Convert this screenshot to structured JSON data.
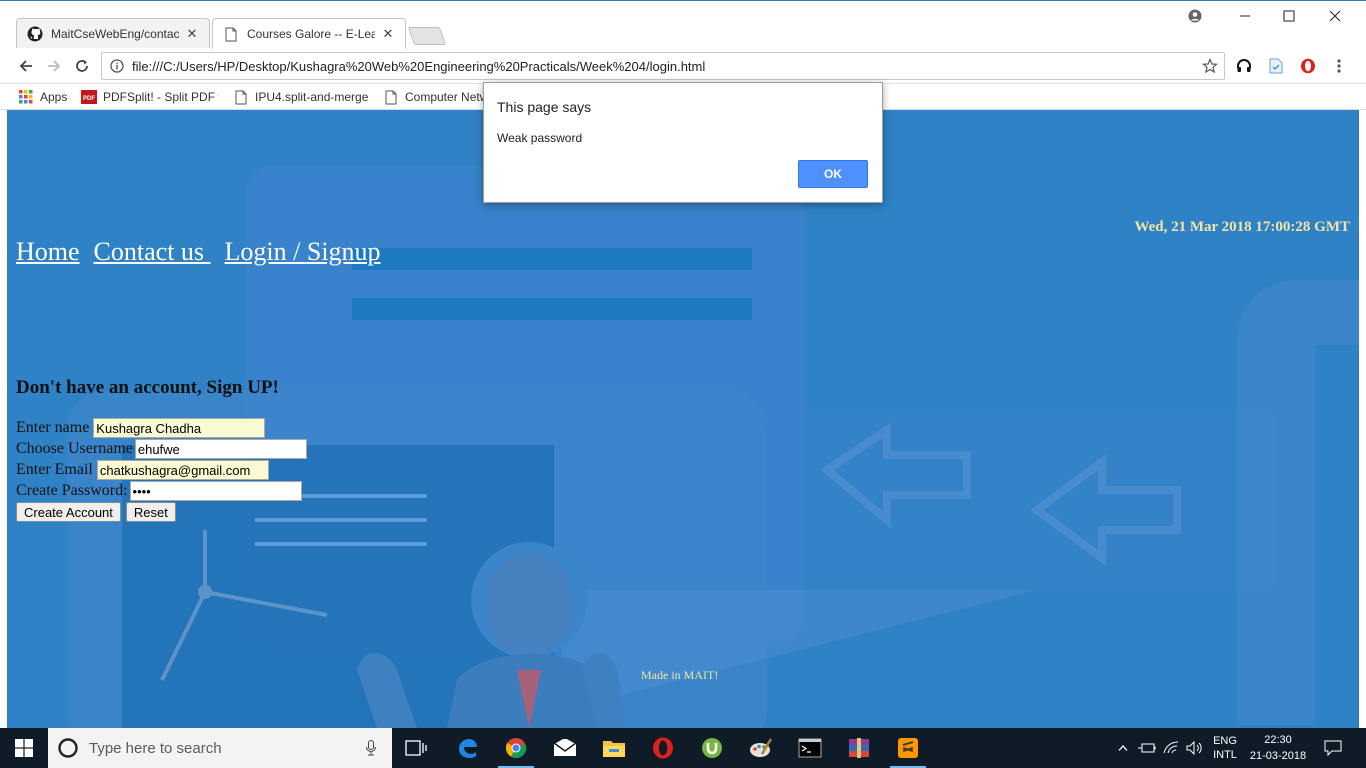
{
  "browser": {
    "tabs": [
      {
        "title": "MaitCseWebEng/contact",
        "active": false,
        "icon": "github-icon"
      },
      {
        "title": "Courses Galore -- E-Lear",
        "active": true,
        "icon": "page-icon"
      }
    ],
    "url": "file:///C:/Users/HP/Desktop/Kushagra%20Web%20Engineering%20Practicals/Week%204/login.html",
    "bookmarks": [
      {
        "label": "Apps",
        "icon": "apps-grid-icon"
      },
      {
        "label": "PDFSplit! - Split PDF f",
        "icon": "pdf-icon"
      },
      {
        "label": "IPU4.split-and-merge",
        "icon": "page-icon"
      },
      {
        "label": "Computer Netw",
        "icon": "page-icon"
      }
    ]
  },
  "page": {
    "datetime": "Wed, 21 Mar 2018 17:00:28 GMT",
    "nav": [
      "Home",
      "Contact us ",
      "Login / Signup"
    ],
    "signup_heading": "Don't have an account, Sign UP!",
    "form": {
      "name_label": "Enter name",
      "name_value": "Kushagra Chadha",
      "username_label": "Choose Username",
      "username_value": "ehufwe",
      "email_label": "Enter Email",
      "email_value": "chatkushagra@gmail.com",
      "password_label": "Create Password:",
      "password_value": "abcd",
      "create_button": "Create Account",
      "reset_button": "Reset"
    },
    "footer": "Made in MAIT!",
    "background_color": "#2f82c6",
    "accent_text_color": "#f3e5a3"
  },
  "dialog": {
    "title": "This page says",
    "message": "Weak password",
    "ok": "OK"
  },
  "taskbar": {
    "search_placeholder": "Type here to search",
    "apps": [
      "task-view-icon",
      "edge-icon",
      "chrome-icon",
      "mail-icon",
      "file-explorer-icon",
      "opera-icon",
      "utorrent-icon",
      "paint-icon",
      "cmd-icon",
      "winrar-icon",
      "sublime-icon"
    ],
    "lang_line1": "ENG",
    "lang_line2": "INTL",
    "time": "22:30",
    "date": "21-03-2018"
  }
}
